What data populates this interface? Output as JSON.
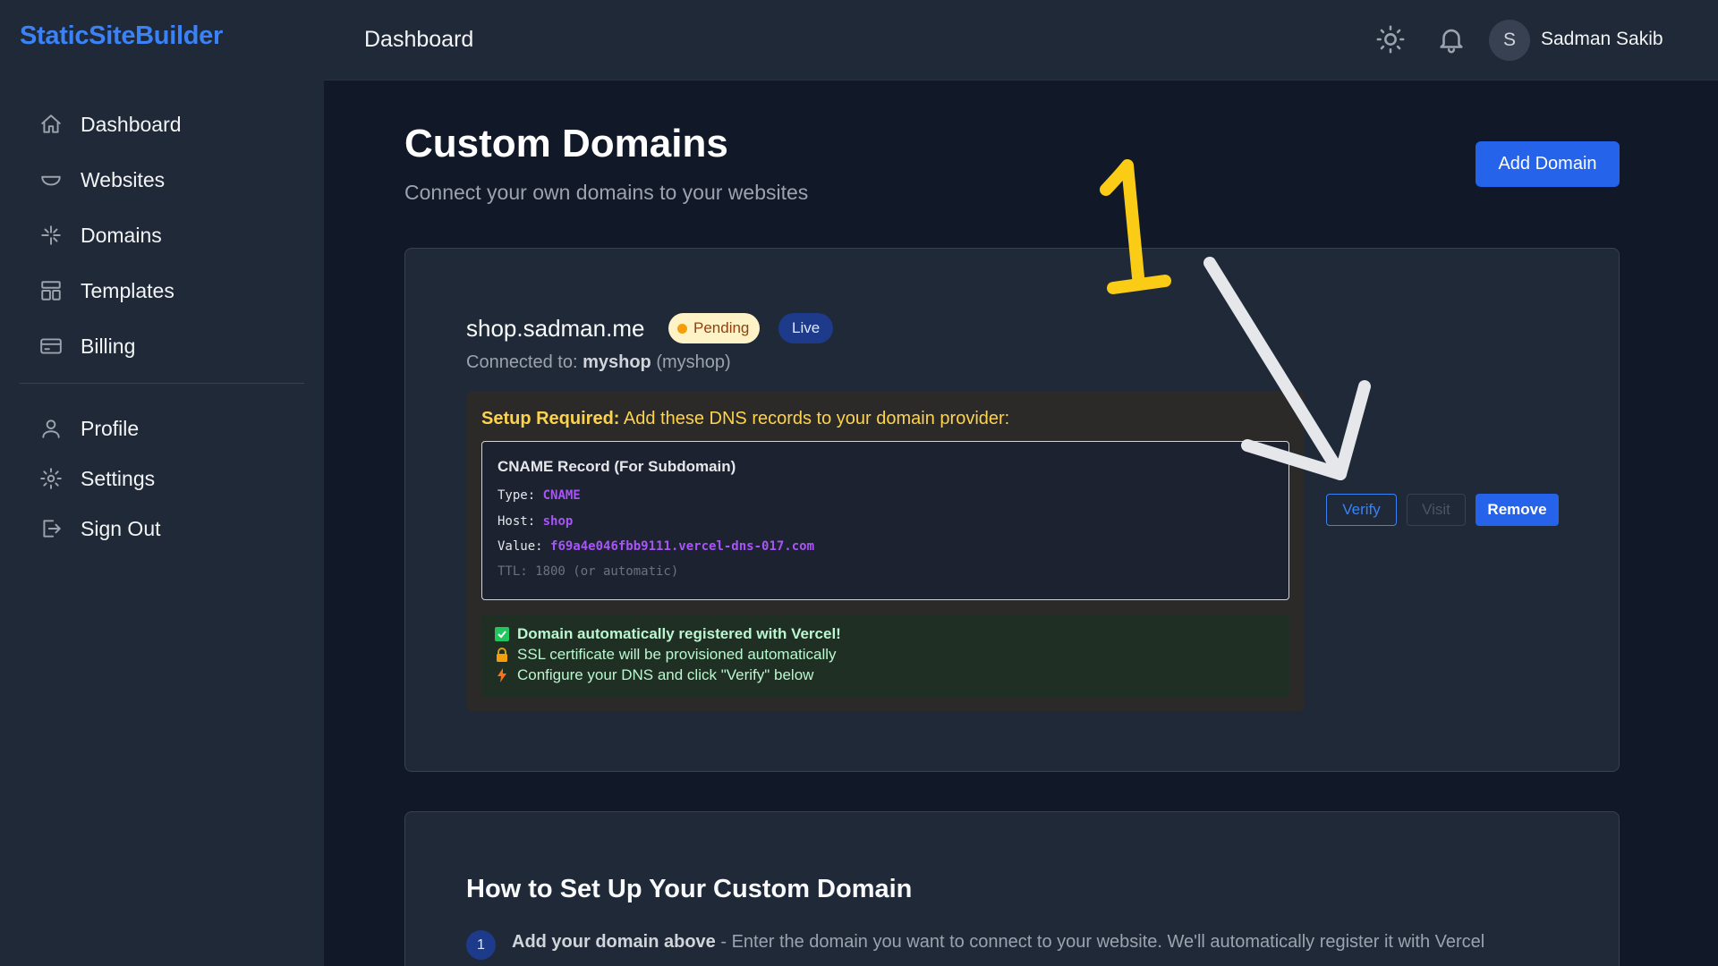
{
  "brand": "StaticSiteBuilder",
  "sidebar": {
    "items": [
      {
        "label": "Dashboard",
        "icon": "home-icon"
      },
      {
        "label": "Websites",
        "icon": "bowl-icon"
      },
      {
        "label": "Domains",
        "icon": "sparkle-icon"
      },
      {
        "label": "Templates",
        "icon": "template-icon"
      },
      {
        "label": "Billing",
        "icon": "card-icon"
      }
    ],
    "secondary": [
      {
        "label": "Profile",
        "icon": "user-icon"
      },
      {
        "label": "Settings",
        "icon": "gear-icon"
      },
      {
        "label": "Sign Out",
        "icon": "sign-out-icon"
      }
    ]
  },
  "header": {
    "title": "Dashboard",
    "avatar_initial": "S",
    "user_name": "Sadman Sakib"
  },
  "main": {
    "title": "Custom Domains",
    "subtitle": "Connect your own domains to your websites",
    "add_button": "Add Domain"
  },
  "domain": {
    "name": "shop.sadman.me",
    "status_pending": "Pending",
    "status_live": "Live",
    "connected_prefix": "Connected to:",
    "connected_site": "myshop",
    "connected_slug": "(myshop)",
    "setup_label": "Setup Required:",
    "setup_text": "Add these DNS records to your domain provider:",
    "record": {
      "title": "CNAME Record (For Subdomain)",
      "type_label": "Type:",
      "type_value": "CNAME",
      "host_label": "Host:",
      "host_value": "shop",
      "value_label": "Value:",
      "value_value": "f69a4e046fbb9111.vercel-dns-017.com",
      "ttl": "TTL: 1800 (or automatic)"
    },
    "messages": [
      "Domain automatically registered with Vercel!",
      "SSL certificate will be provisioned automatically",
      "Configure your DNS and click \"Verify\" below"
    ],
    "actions": {
      "verify": "Verify",
      "visit": "Visit",
      "remove": "Remove"
    }
  },
  "guide": {
    "title": "How to Set Up Your Custom Domain",
    "step1_number": "1",
    "step1_bold": "Add your domain above",
    "step1_text": " - Enter the domain you want to connect to your website. We'll automatically register it with Vercel"
  },
  "annotation": {
    "number": "1"
  },
  "colors": {
    "accent": "#2563eb",
    "brand": "#3b82f6",
    "pending_bg": "#fef3c7",
    "live_bg": "#1e3a8a",
    "code_value": "#a855f7",
    "annotation_number": "#facc15",
    "annotation_arrow": "#e5e7eb"
  }
}
